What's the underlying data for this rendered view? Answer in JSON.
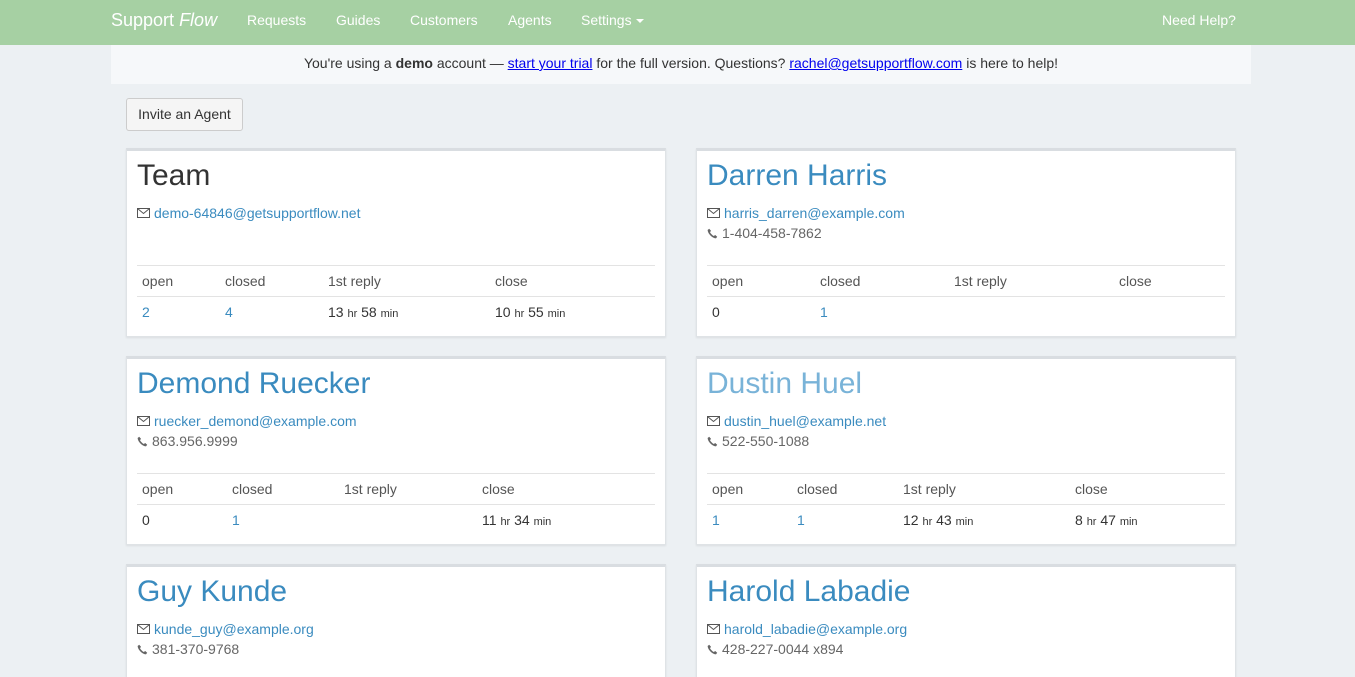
{
  "navbar": {
    "brand_main": "Support",
    "brand_italic": "Flow",
    "items": [
      "Requests",
      "Guides",
      "Customers",
      "Agents",
      "Settings"
    ],
    "help": "Need Help?"
  },
  "banner": {
    "t1": "You're using a ",
    "bold": "demo",
    "t2": " account — ",
    "trial_link": "start your trial",
    "t3": " for the full version. Questions? ",
    "email_link": "rachel@getsupportflow.com",
    "t4": " is here to help!"
  },
  "invite_button": "Invite an Agent",
  "stat_headers": [
    "open",
    "closed",
    "1st reply",
    "close"
  ],
  "units": {
    "hr": "hr",
    "min": "min"
  },
  "cards": [
    {
      "name": "Team",
      "email": "demo-64846@getsupportflow.net",
      "phone": "",
      "open": "2",
      "closed": "4",
      "reply_hr": "13",
      "reply_min": "58",
      "close_hr": "10",
      "close_min": "55"
    },
    {
      "name": "Darren Harris",
      "email": "harris_darren@example.com",
      "phone": "1-404-458-7862",
      "open": "0",
      "closed": "1",
      "reply_hr": "",
      "reply_min": "",
      "close_hr": "",
      "close_min": ""
    },
    {
      "name": "Demond Ruecker",
      "email": "ruecker_demond@example.com",
      "phone": "863.956.9999",
      "open": "0",
      "closed": "1",
      "reply_hr": "",
      "reply_min": "",
      "close_hr": "11",
      "close_min": "34"
    },
    {
      "name": "Dustin Huel",
      "email": "dustin_huel@example.net",
      "phone": "522-550-1088",
      "open": "1",
      "closed": "1",
      "reply_hr": "12",
      "reply_min": "43",
      "close_hr": "8",
      "close_min": "47"
    },
    {
      "name": "Guy Kunde",
      "email": "kunde_guy@example.org",
      "phone": "381-370-9768"
    },
    {
      "name": "Harold Labadie",
      "email": "harold_labadie@example.org",
      "phone": "428-227-0044 x894"
    }
  ]
}
